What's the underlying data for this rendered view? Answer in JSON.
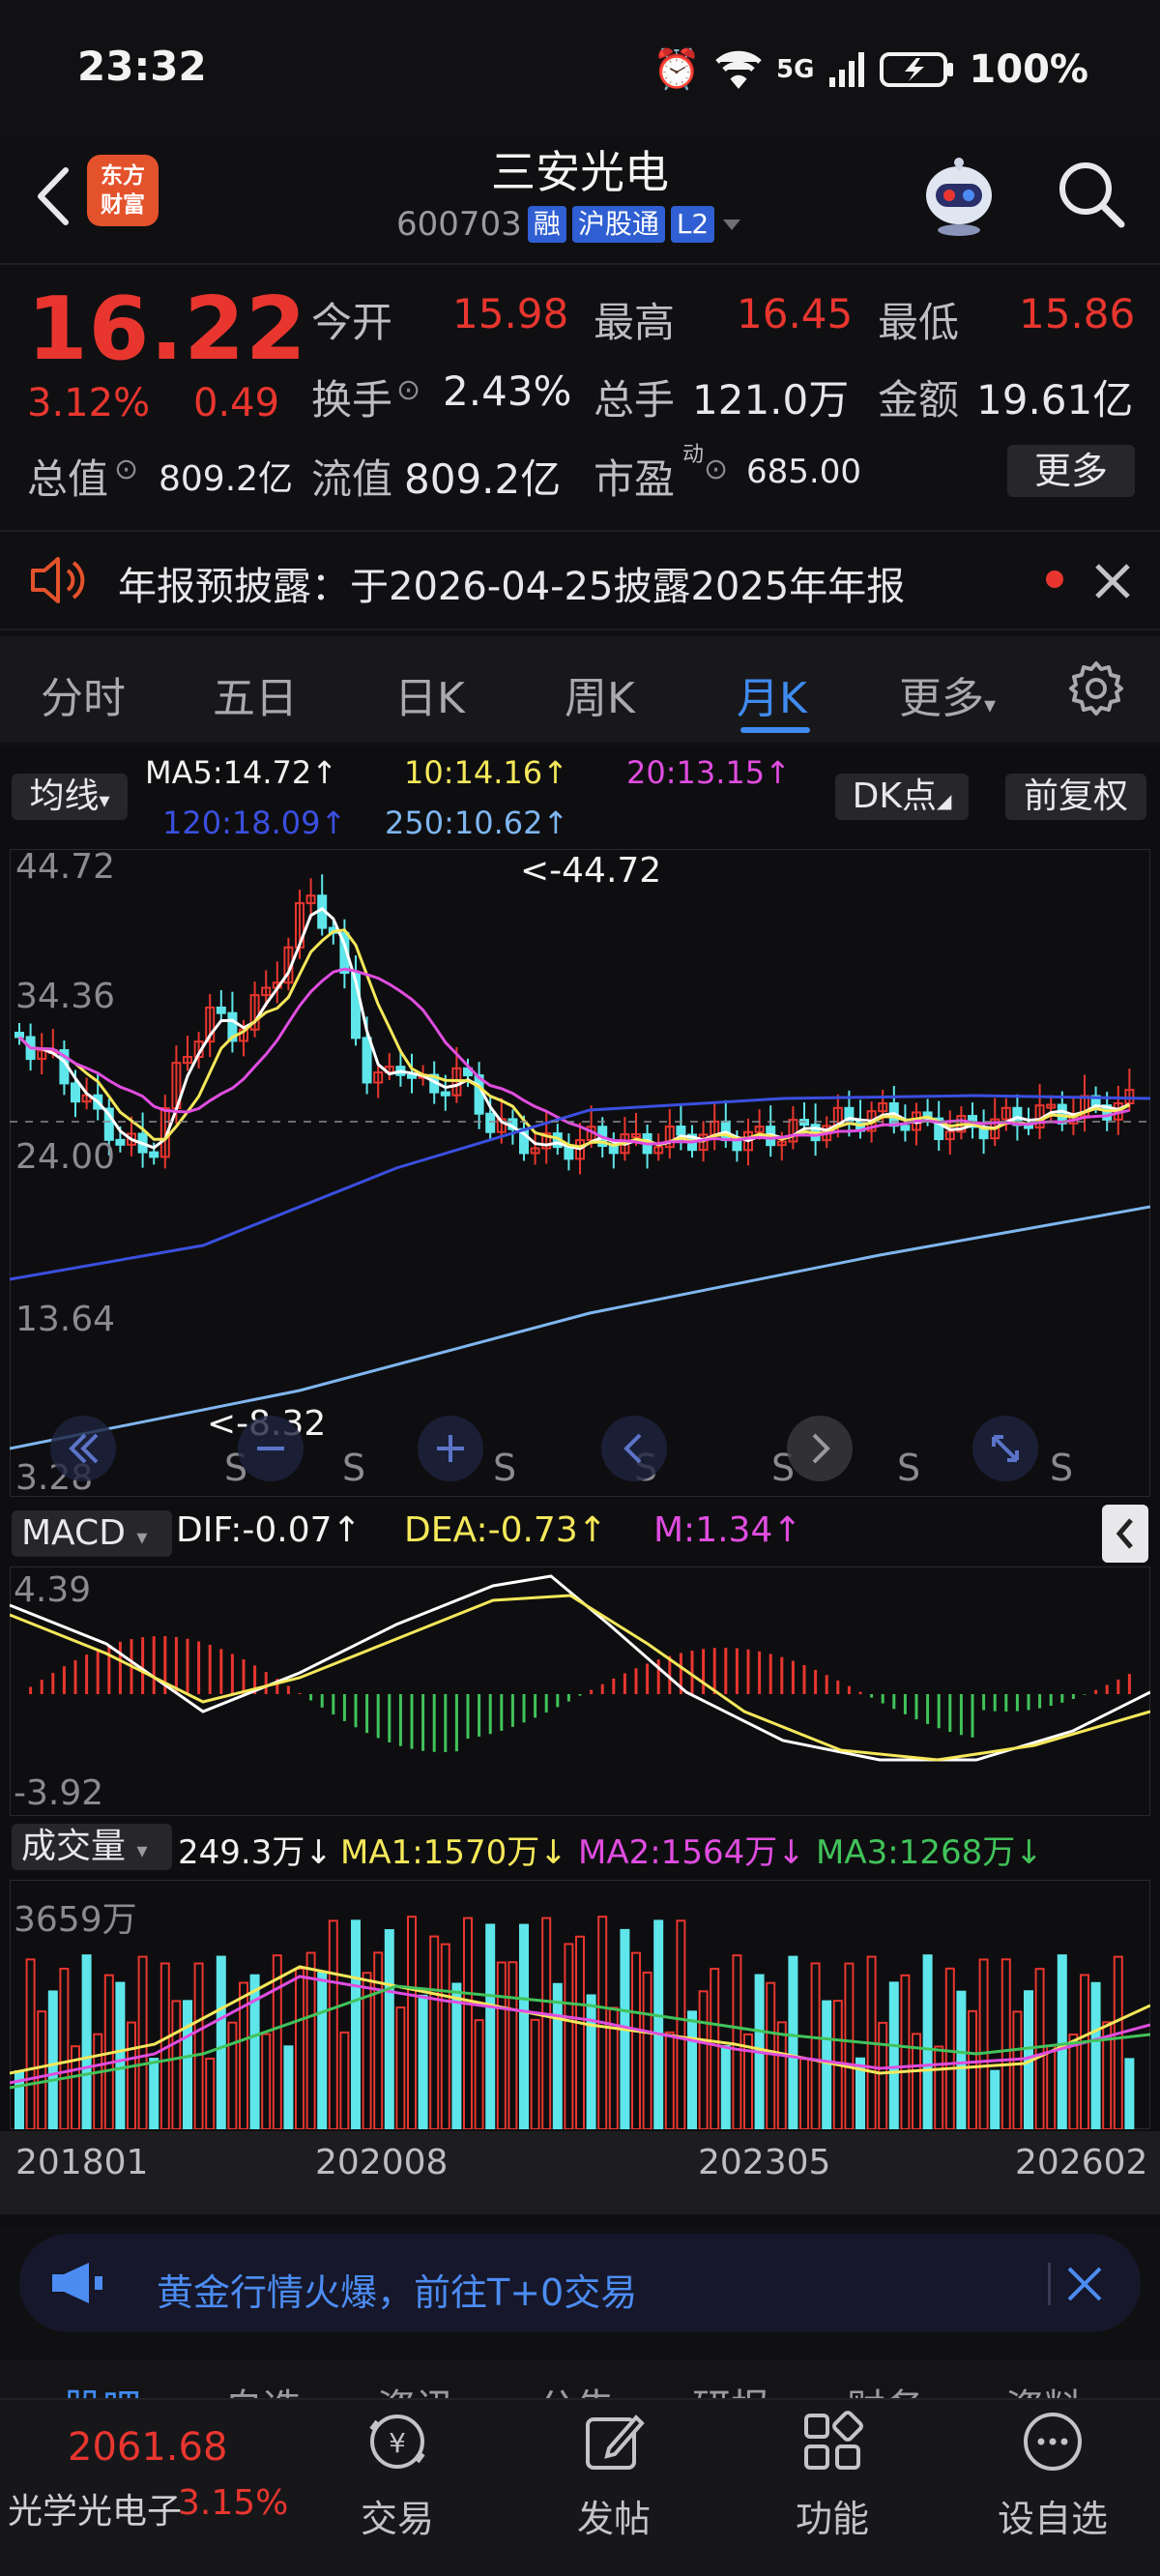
{
  "status": {
    "time": "23:32",
    "network": "5G",
    "battery": "100%"
  },
  "header": {
    "logo_line1": "东方",
    "logo_line2": "财富",
    "stock_name": "三安光电",
    "stock_code": "600703",
    "tags": [
      "融",
      "沪股通",
      "L2"
    ]
  },
  "quote": {
    "price": "16.22",
    "change_pct": "3.12%",
    "change_amt": "0.49",
    "open_label": "今开",
    "open": "15.98",
    "high_label": "最高",
    "high": "16.45",
    "low_label": "最低",
    "low": "15.86",
    "turnover_label": "换手",
    "turnover": "2.43%",
    "volume_label": "总手",
    "volume": "121.0万",
    "amount_label": "金额",
    "amount": "19.61亿",
    "total_mv_label": "总值",
    "total_mv": "809.2亿",
    "float_mv_label": "流值",
    "float_mv": "809.2亿",
    "pe_label": "市盈",
    "pe_super": "动",
    "pe": "685.00",
    "more_label": "更多"
  },
  "notice": {
    "text": "年报预披露：于2026-04-25披露2025年年报"
  },
  "period_tabs": [
    "分时",
    "五日",
    "日K",
    "周K",
    "月K",
    "更多"
  ],
  "chart": {
    "ma_switch": "均线",
    "ma5": "MA5:14.72↑",
    "ma10": "10:14.16↑",
    "ma20": "20:13.15↑",
    "ma120": "120:18.09↑",
    "ma250": "250:10.62↑",
    "dk_label": "DK点",
    "adjust_label": "前复权",
    "y_labels": [
      "44.72",
      "34.36",
      "24.00",
      "13.64",
      "3.28"
    ],
    "max_marker": "<-44.72",
    "min_marker": "<-8.32",
    "signal": "S",
    "macd_selector": "MACD",
    "dif": "DIF:-0.07↑",
    "dea": "DEA:-0.73↑",
    "m": "M:1.34↑",
    "macd_top": "4.39",
    "macd_bottom": "-3.92",
    "vol_selector": "成交量",
    "vol_now": "249.3万↓",
    "vol_ma1": "MA1:1570万↓",
    "vol_ma2": "MA2:1564万↓",
    "vol_ma3": "MA3:1268万↓",
    "vol_top": "3659万",
    "x_labels": [
      "201801",
      "202008",
      "202305",
      "202602"
    ],
    "colors": {
      "up": "#e8362f",
      "down": "#5ee6ea",
      "ma5": "#ffffff",
      "ma10": "#f5e85a",
      "ma20": "#e04de0",
      "ma120": "#3b4fe0",
      "ma250": "#7fb6f0"
    }
  },
  "promo": {
    "text": "黄金行情火爆，前往T+0交易"
  },
  "partial_tabs": [
    "股吧",
    "自选",
    "资讯",
    "公告",
    "研报",
    "财务",
    "资料"
  ],
  "bottom": {
    "index_value": "2061.68",
    "index_name": "光学光电子",
    "index_pct": "3.15%",
    "nav": [
      "交易",
      "发帖",
      "功能",
      "设自选"
    ]
  }
}
